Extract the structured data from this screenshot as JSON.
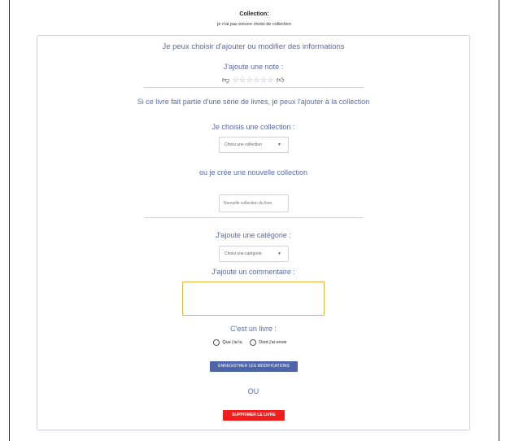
{
  "header": {
    "title": "Collection:",
    "subtitle": "je n'ai pas encore choisi de collection"
  },
  "panel": {
    "heading": "Je peux choisir d'ajouter ou modifier des informations",
    "rating_label": "J'ajoute une note :",
    "rating": {
      "stars_filled": 0,
      "stars_total": 6,
      "star_glyph": "☆"
    },
    "series_text": "Si ce livre fait partie d'une série de livres, je peux l'ajouter à la collection",
    "collection_label": "Je choisis une collection :",
    "collection_select": {
      "value": "Choisi une collection"
    },
    "new_collection_label": "ou je crée une nouvelle collection",
    "new_collection_input": {
      "placeholder": "Nouvelle collection du livre"
    },
    "category_label": "J'ajoute une catégorie :",
    "category_select": {
      "value": "Choisi une catégorie"
    },
    "comment_label": "J'ajoute un commentaire :",
    "book_type_label": "C'est un livre :",
    "radios": [
      {
        "label": "Que j'ai lu"
      },
      {
        "label": "Dont j'ai envie"
      }
    ],
    "save_button": "ENREGISTRER LES MODIFICATIONS",
    "or_text": "OU",
    "delete_button": "SUPPRIMER LE LIVRE"
  },
  "colors": {
    "accent": "#5b6aa8",
    "save_button": "#4e64a8",
    "delete_button": "#f21e1e",
    "textarea_border": "#e9b437"
  },
  "icons": [
    "thumbs-down-icon",
    "star-icon",
    "thumbs-up-icon",
    "caret-down-icon"
  ]
}
